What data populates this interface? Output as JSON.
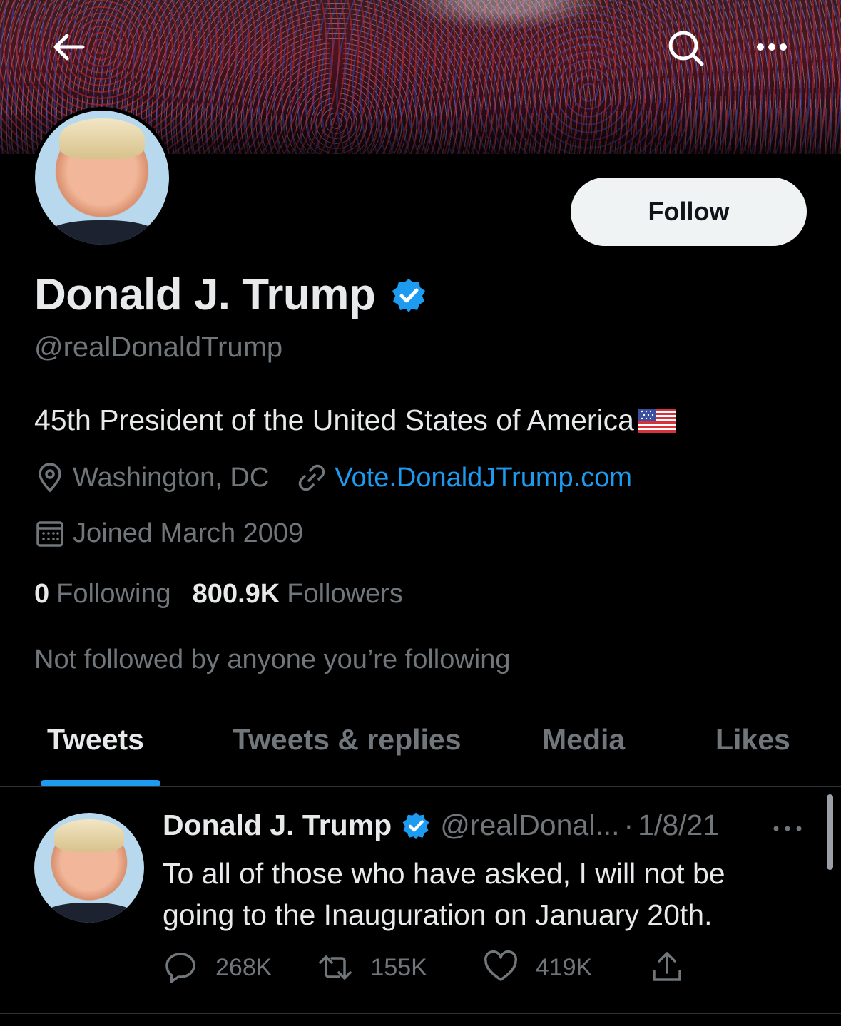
{
  "header": {
    "back_icon": "arrow-left-icon",
    "search_icon": "search-icon",
    "more_icon": "more-horizontal-icon"
  },
  "profile": {
    "display_name": "Donald J. Trump",
    "handle": "@realDonaldTrump",
    "bio": "45th President of the United States of America",
    "bio_emoji": "us-flag-icon",
    "location": "Washington, DC",
    "website": "Vote.DonaldJTrump.com",
    "joined": "Joined March 2009",
    "following_count": "0",
    "following_label": "Following",
    "followers_count": "800.9K",
    "followers_label": "Followers",
    "followed_by_note": "Not followed by anyone you’re following",
    "follow_button_label": "Follow"
  },
  "tabs": [
    {
      "label": "Tweets",
      "active": true
    },
    {
      "label": "Tweets & replies",
      "active": false
    },
    {
      "label": "Media",
      "active": false
    },
    {
      "label": "Likes",
      "active": false
    }
  ],
  "tweet": {
    "author_name": "Donald J. Trump",
    "author_handle": "@realDonal...",
    "separator": "·",
    "date": "1/8/21",
    "text": "To all of those who have asked, I will not be going to the Inauguration on January 20th.",
    "replies": "268K",
    "retweets": "155K",
    "likes": "419K"
  },
  "colors": {
    "background": "#000000",
    "primary_text": "#e7e9ea",
    "secondary_text": "#71767b",
    "accent": "#1d9bf0",
    "follow_button_bg": "#eff3f4"
  }
}
